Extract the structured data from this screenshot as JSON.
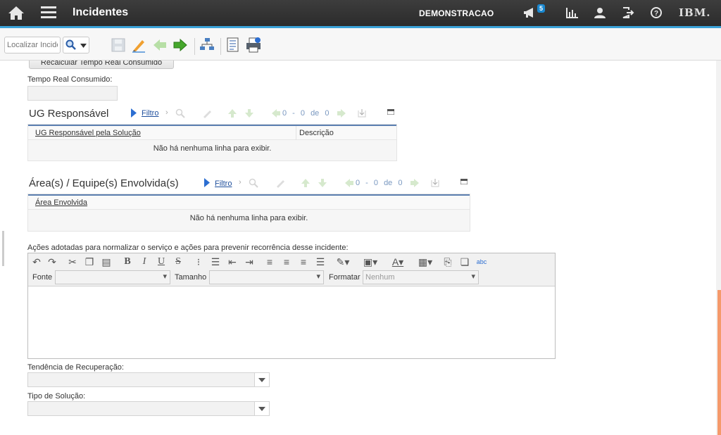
{
  "header": {
    "title": "Incidentes",
    "user": "DEMONSTRACAO",
    "notifications_count": "5",
    "logo": "IBM."
  },
  "toolbar": {
    "search_placeholder": "Localizar Incidente"
  },
  "form": {
    "recalc_button": "Recalcular Tempo Real Consumido",
    "tempo_label": "Tempo Real Consumido:",
    "tempo_value": ""
  },
  "ug_section": {
    "title": "UG Responsável",
    "filter": "Filtro",
    "pager": "0 - 0 de 0",
    "columns": [
      "UG Responsável pela Solução",
      "Descrição"
    ],
    "empty": "Não há nenhuma linha para exibir."
  },
  "area_section": {
    "title": "Área(s) / Equipe(s) Envolvida(s)",
    "filter": "Filtro",
    "pager": "0 - 0 de 0",
    "columns": [
      "Área Envolvida"
    ],
    "empty": "Não há nenhuma linha para exibir."
  },
  "actions": {
    "label": "Ações adotadas para normalizar o serviço e ações para prevenir recorrência desse incidente:",
    "font_label": "Fonte",
    "size_label": "Tamanho",
    "format_label": "Formatar",
    "format_value": "Nenhum"
  },
  "tendencia": {
    "label": "Tendência de Recuperação:",
    "value": ""
  },
  "tipo": {
    "label": "Tipo de Solução:",
    "value": ""
  }
}
